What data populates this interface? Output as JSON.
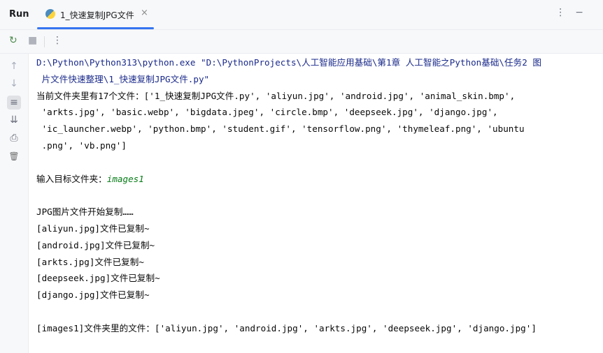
{
  "tabbar": {
    "run_label": "Run",
    "tab_label": "1_快速复制JPG文件",
    "close": "×",
    "more": "⋮",
    "minimize": "−"
  },
  "toolbar": {
    "rerun": "↻",
    "stop": "■",
    "more": "⋮"
  },
  "gutter": {
    "up": "↑",
    "down": "↓",
    "wrap": "≡",
    "scroll_end": "⇊",
    "print": "⎙",
    "clear": "🗑"
  },
  "console": {
    "cmd1": "D:\\Python\\Python313\\python.exe \"D:\\PythonProjects\\人工智能应用基础\\第1章 人工智能之Python基础\\任务2 图",
    "cmd2": " 片文件快速整理\\1_快速复制JPG文件.py\"",
    "out1": "当前文件夹里有17个文件：['1_快速复制JPG文件.py', 'aliyun.jpg', 'android.jpg', 'animal_skin.bmp',",
    "out2": " 'arkts.jpg', 'basic.webp', 'bigdata.jpeg', 'circle.bmp', 'deepseek.jpg', 'django.jpg',",
    "out3": " 'ic_launcher.webp', 'python.bmp', 'student.gif', 'tensorflow.png', 'thymeleaf.png', 'ubuntu",
    "out4": " .png', 'vb.png']",
    "prompt": "输入目标文件夹：",
    "input": "images1",
    "start": "JPG图片文件开始复制……",
    "copied": [
      "[aliyun.jpg]文件已复制~",
      "[android.jpg]文件已复制~",
      "[arkts.jpg]文件已复制~",
      "[deepseek.jpg]文件已复制~",
      "[django.jpg]文件已复制~"
    ],
    "result": "[images1]文件夹里的文件：['aliyun.jpg', 'android.jpg', 'arkts.jpg', 'deepseek.jpg', 'django.jpg']"
  }
}
